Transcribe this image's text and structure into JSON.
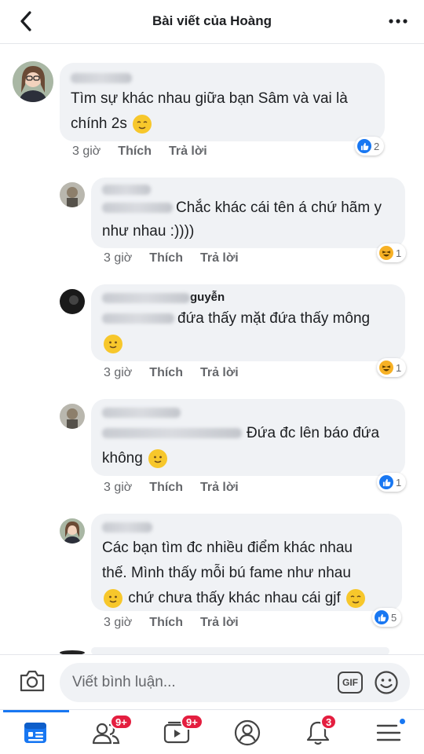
{
  "header": {
    "title": "Bài viết của Hoàng"
  },
  "comments": [
    {
      "text": "Tìm sự khác nhau giữa bạn Sâm và vai là chính 2s",
      "time": "3 giờ",
      "like": "Thích",
      "reply": "Trả lời",
      "react_count": "2"
    },
    {
      "text": "Chắc khác cái tên á chứ hãm y như nhau :))))",
      "time": "3 giờ",
      "like": "Thích",
      "reply": "Trả lời",
      "react_count": "1"
    },
    {
      "name_suffix": "guyễn",
      "text": "đứa thấy mặt đứa thấy mông",
      "time": "3 giờ",
      "like": "Thích",
      "reply": "Trả lời",
      "react_count": "1"
    },
    {
      "text_a": "Đứa đc lên báo đứa",
      "text_b": "không",
      "time": "3 giờ",
      "like": "Thích",
      "reply": "Trả lời",
      "react_count": "1"
    },
    {
      "line1": "Các bạn tìm đc nhiều điểm khác nhau",
      "line2": "thế. Mình thấy mỗi bú fame như nhau",
      "line3": "chứ chưa thấy khác nhau cái gjf",
      "time": "3 giờ",
      "like": "Thích",
      "reply": "Trả lời",
      "react_count": "5"
    }
  ],
  "composer": {
    "placeholder": "Viết bình luận...",
    "gif_label": "GIF"
  },
  "nav": {
    "badges": {
      "friends": "9+",
      "watch": "9+",
      "notifications": "3"
    }
  },
  "colors": {
    "accent": "#1877f2",
    "badge": "#e41e3f",
    "bubble": "#f0f2f5"
  }
}
